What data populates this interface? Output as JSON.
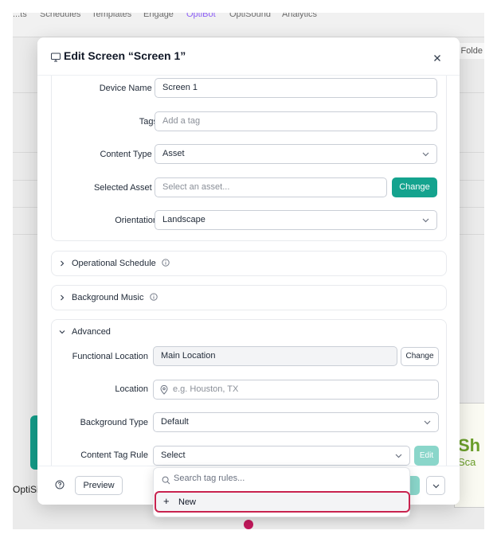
{
  "background": {
    "nav_items": [
      {
        "label": "...ts"
      },
      {
        "label": "Schedules"
      },
      {
        "label": "Templates"
      },
      {
        "label": "Engage"
      },
      {
        "label": "OptiBot"
      },
      {
        "label": "OptiSound"
      },
      {
        "label": "Analytics"
      }
    ],
    "right_button": "w Folde",
    "brand_partial": "OptiSi",
    "promo": {
      "line1": "Sh",
      "line2": "Sca"
    }
  },
  "modal": {
    "title": "Edit Screen “Screen 1”",
    "fields": {
      "device_name": {
        "label": "Device Name",
        "value": "Screen 1",
        "required": true
      },
      "tags": {
        "label": "Tags",
        "placeholder": "Add a tag"
      },
      "content_type": {
        "label": "Content Type",
        "value": "Asset",
        "required": true
      },
      "selected_asset": {
        "label": "Selected Asset",
        "placeholder": "Select an asset...",
        "required": true,
        "button": "Change"
      },
      "orientation": {
        "label": "Orientation",
        "value": "Landscape"
      }
    },
    "sections": {
      "operational_schedule": "Operational Schedule",
      "background_music": "Background Music",
      "advanced": "Advanced"
    },
    "advanced": {
      "functional_location": {
        "label": "Functional Location",
        "value": "Main Location",
        "button": "Change"
      },
      "location": {
        "label": "Location",
        "placeholder": "e.g. Houston, TX"
      },
      "background_type": {
        "label": "Background Type",
        "value": "Default"
      },
      "content_tag_rule": {
        "label": "Content Tag Rule",
        "value": "Select",
        "button": "Edit"
      }
    },
    "footer": {
      "preview_label": "Preview"
    }
  },
  "dropdown": {
    "search_placeholder": "Search tag rules...",
    "new_label": "New",
    "plus": "+"
  },
  "colors": {
    "accent": "#14a38e",
    "required": "#dc2626",
    "highlight": "#c8234f"
  }
}
